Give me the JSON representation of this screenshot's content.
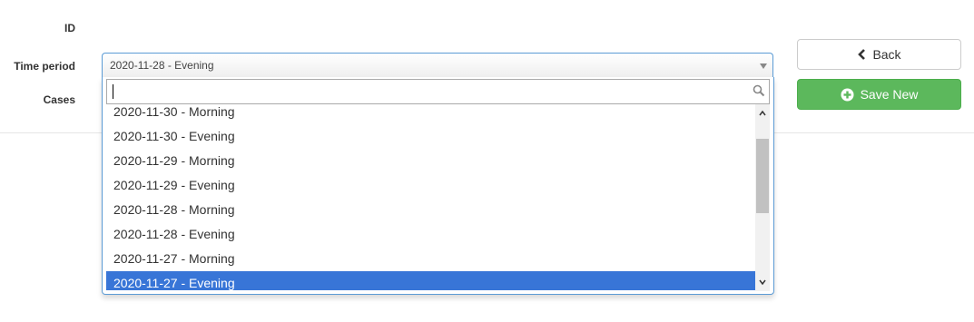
{
  "form": {
    "id_label": "ID",
    "time_period_label": "Time period",
    "cases_label": "Cases"
  },
  "select": {
    "selected_value": "2020-11-28 - Evening",
    "search_value": "",
    "options": [
      {
        "label": "2020-11-30 - Morning",
        "selected": false
      },
      {
        "label": "2020-11-30 - Evening",
        "selected": false
      },
      {
        "label": "2020-11-29 - Morning",
        "selected": false
      },
      {
        "label": "2020-11-29 - Evening",
        "selected": false
      },
      {
        "label": "2020-11-28 - Morning",
        "selected": false
      },
      {
        "label": "2020-11-28 - Evening",
        "selected": false
      },
      {
        "label": "2020-11-27 - Morning",
        "selected": false
      },
      {
        "label": "2020-11-27 - Evening",
        "selected": true
      }
    ]
  },
  "buttons": {
    "back_label": "Back",
    "back_icon": "chevron-left-icon",
    "save_new_label": "Save New",
    "save_new_icon": "plus-circle-icon"
  },
  "colors": {
    "highlight": "#3875d7",
    "success": "#5cb85c",
    "focus_border": "#5b9bd5"
  }
}
